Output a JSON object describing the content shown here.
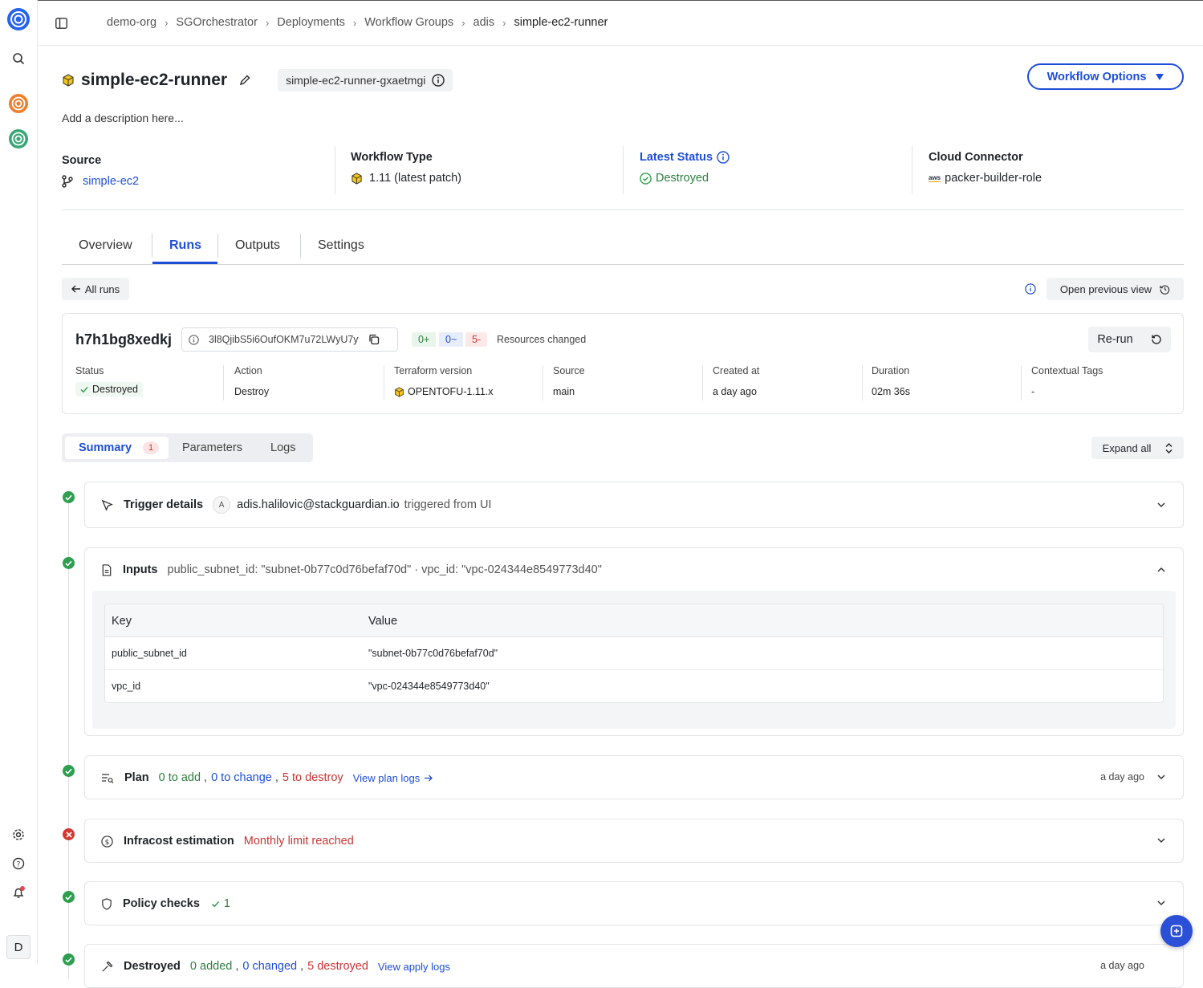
{
  "sidebar": {
    "avatar_letter": "D"
  },
  "breadcrumb": [
    "demo-org",
    "SGOrchestrator",
    "Deployments",
    "Workflow Groups",
    "adis",
    "simple-ec2-runner"
  ],
  "header": {
    "title": "simple-ec2-runner",
    "id_tag": "simple-ec2-runner-gxaetmgi",
    "options_label": "Workflow Options",
    "description": "Add a description here..."
  },
  "info": {
    "source_label": "Source",
    "source_value": "simple-ec2",
    "type_label": "Workflow Type",
    "type_value": "1.11 (latest patch)",
    "status_label": "Latest Status",
    "status_value": "Destroyed",
    "connector_label": "Cloud Connector",
    "connector_value": "packer-builder-role",
    "aws": "aws"
  },
  "tabs": [
    "Overview",
    "Runs",
    "Outputs",
    "Settings"
  ],
  "all_runs": "All runs",
  "open_prev": "Open previous view",
  "run": {
    "id": "h7h1bg8xedkj",
    "hash": "3l8QjibS5i6OufOKM7u72LWyU7y",
    "add": "0+",
    "change": "0~",
    "destroy": "5-",
    "resources": "Resources changed",
    "rerun": "Re-run",
    "cols": [
      {
        "label": "Status",
        "value": "Destroyed"
      },
      {
        "label": "Action",
        "value": "Destroy"
      },
      {
        "label": "Terraform version",
        "value": "OPENTOFU-1.11.x"
      },
      {
        "label": "Source",
        "value": "main"
      },
      {
        "label": "Created at",
        "value": "a day ago"
      },
      {
        "label": "Duration",
        "value": "02m 36s"
      },
      {
        "label": "Contextual Tags",
        "value": "-"
      }
    ]
  },
  "subtabs": {
    "summary": "Summary",
    "count": "1",
    "parameters": "Parameters",
    "logs": "Logs",
    "expand": "Expand all"
  },
  "trigger": {
    "title": "Trigger details",
    "avatar": "A",
    "user": "adis.halilovic@stackguardian.io",
    "suffix": "triggered from UI"
  },
  "inputs": {
    "title": "Inputs",
    "summary": "public_subnet_id: \"subnet-0b77c0d76befaf70d\" · vpc_id: \"vpc-024344e8549773d40\"",
    "key_h": "Key",
    "value_h": "Value",
    "rows": [
      {
        "k": "public_subnet_id",
        "v": "\"subnet-0b77c0d76befaf70d\""
      },
      {
        "k": "vpc_id",
        "v": "\"vpc-024344e8549773d40\""
      }
    ]
  },
  "plan": {
    "title": "Plan",
    "add": "0 to add",
    "change": "0 to change",
    "destroy": "5 to destroy",
    "comma": ",",
    "link": "View plan logs",
    "time": "a day ago"
  },
  "infracost": {
    "title": "Infracost estimation",
    "msg": "Monthly limit reached"
  },
  "policy": {
    "title": "Policy checks",
    "count": "1"
  },
  "destroyed": {
    "title": "Destroyed",
    "added": "0 added",
    "changed": "0 changed",
    "destroyed": "5 destroyed",
    "link": "View apply logs",
    "time": "a day ago"
  }
}
